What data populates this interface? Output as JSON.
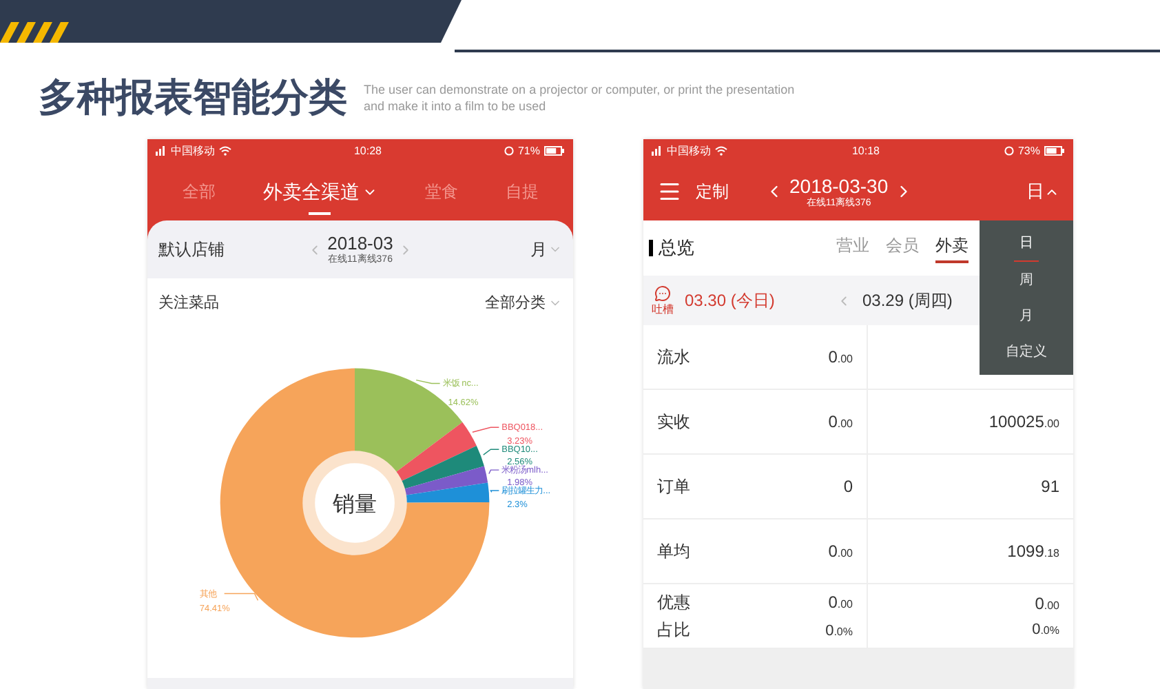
{
  "slide": {
    "title": "多种报表智能分类",
    "subtitle": [
      "The user can demonstrate on a projector or computer, or print the presentation",
      "and make it into a film to be used"
    ]
  },
  "phone_left": {
    "status_bar": {
      "carrier": "中国移动",
      "time": "10:28",
      "battery": "71%"
    },
    "tabs": [
      {
        "label": "全部",
        "selected": false
      },
      {
        "label": "外卖全渠道",
        "selected": true
      },
      {
        "label": "堂食",
        "selected": false
      },
      {
        "label": "自提",
        "selected": false
      }
    ],
    "store": "默认店铺",
    "period": "2018-03",
    "online_status": "在线11离线376",
    "granularity": "月",
    "filter_label": "关注菜品",
    "filter_value": "全部分类",
    "chart_center_label": "销量",
    "chart_data": {
      "type": "donut",
      "categories": [
        "米饭 nc...",
        "BBQ018...",
        "BBQ10...",
        "米粉汤mlh...",
        "刷拉罐生力...",
        "其他"
      ],
      "values": [
        14.62,
        3.23,
        2.56,
        1.98,
        2.3,
        74.41
      ],
      "value_labels": [
        "14.62%",
        "3.23%",
        "2.56%",
        "1.98%",
        "2.3%",
        "74.41%"
      ],
      "colors": [
        "#9bc05a",
        "#ee5560",
        "#1e8a7a",
        "#7b5bc9",
        "#1e90d8",
        "#f6a45a"
      ]
    }
  },
  "phone_right": {
    "status_bar": {
      "carrier": "中国移动",
      "time": "10:18",
      "battery": "73%"
    },
    "header": {
      "mode": "定制",
      "date": "2018-03-30",
      "online_status": "在线11离线376",
      "granularity": "日"
    },
    "section_title": "总览",
    "section_tabs": [
      {
        "label": "营业",
        "selected": false
      },
      {
        "label": "会员",
        "selected": false
      },
      {
        "label": "外卖",
        "selected": true
      }
    ],
    "feedback_label": "吐槽",
    "today": "03.30 (今日)",
    "previous": "03.29 (周四)",
    "rows": [
      {
        "label": "流水",
        "today": "0.00"
      },
      {
        "label": "实收",
        "today": "0.00",
        "previous": "100025.00"
      },
      {
        "label": "订单",
        "today": "0",
        "previous": "91"
      },
      {
        "label": "单均",
        "today": "0.00",
        "previous": "1099.18"
      },
      {
        "label": "优惠",
        "today": "0.00",
        "previous": "0.00",
        "sub_label": "占比",
        "sub_today": "0.0%",
        "sub_previous": "0.0%"
      }
    ],
    "dropdown": [
      {
        "label": "日",
        "selected": true
      },
      {
        "label": "周",
        "selected": false
      },
      {
        "label": "月",
        "selected": false
      },
      {
        "label": "自定义",
        "selected": false
      }
    ]
  }
}
